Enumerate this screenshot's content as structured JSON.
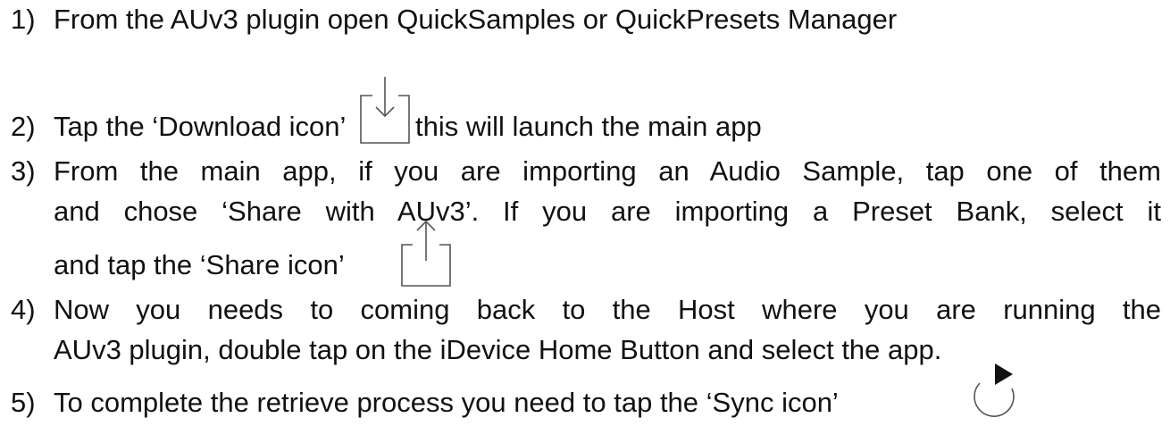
{
  "steps": [
    {
      "num": "1)",
      "text": "From the AUv3 plugin open QuickSamples or QuickPresets Manager"
    },
    {
      "num": "2)",
      "before_icon": "Tap the ‘Download icon’",
      "after_icon": "this will launch the main app",
      "icon": "download-icon"
    },
    {
      "num": "3)",
      "line1": "From the main app, if you are importing an Audio Sample, tap one of them",
      "line2": "and chose ‘Share with AUv3’. If you are importing a Preset Bank, select it",
      "line3": "and tap the ‘Share icon’",
      "icon": "share-icon"
    },
    {
      "num": "4)",
      "line1": "Now you needs to coming back to the Host where you are running the",
      "line2": "AUv3 plugin, double tap on the iDevice Home Button and select the app."
    },
    {
      "num": "5)",
      "text": "To complete the retrieve process you need to tap the ‘Sync icon’",
      "icon": "sync-icon"
    }
  ],
  "colors": {
    "text": "#111111",
    "icon_stroke": "#555555",
    "icon_fill": "#111111"
  }
}
